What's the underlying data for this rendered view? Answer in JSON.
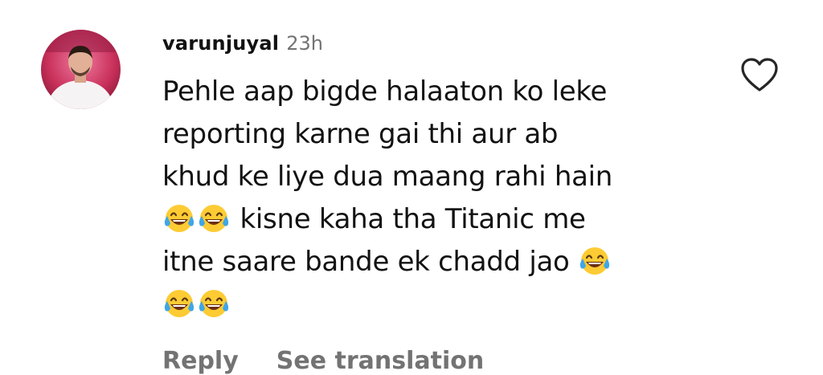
{
  "comment": {
    "username": "varunjuyal",
    "time": "23h",
    "text_lines": [
      "Pehle aap bigde halaaton ko leke",
      "reporting karne gai thi aur ab",
      "khud ke liye dua maang rahi hain",
      "kisne kaha tha Titanic me",
      "itne saare bande ek chadd jao"
    ],
    "emoji": "face-with-tears-of-joy",
    "reply_label": "Reply",
    "see_translation_label": "See translation",
    "like_icon": "heart-outline-icon"
  },
  "colors": {
    "text": "#121212",
    "muted": "#737373",
    "emoji_face": "#FDCB33"
  }
}
